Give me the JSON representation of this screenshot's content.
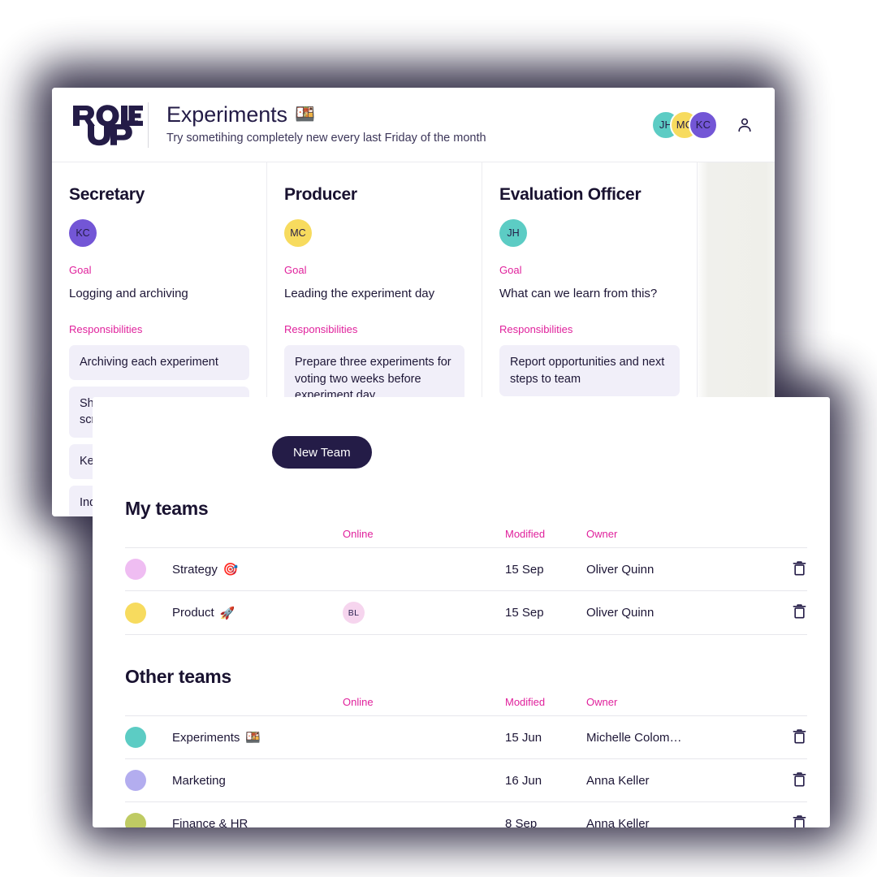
{
  "board": {
    "logo_text_top": "ROLE",
    "logo_text_bottom": "UP",
    "title": "Experiments",
    "title_emoji": "🍱",
    "subtitle": "Try sometihing completely new every last Friday of the month",
    "header_avatars": [
      {
        "initials": "JH",
        "color": "#5CCCC4"
      },
      {
        "initials": "MC",
        "color": "#F7DB5E"
      },
      {
        "initials": "KC",
        "color": "#7356D6"
      }
    ],
    "account_icon": "person-icon",
    "labels": {
      "goal": "Goal",
      "responsibilities": "Responsibilities"
    },
    "columns": [
      {
        "role": "Secretary",
        "avatar": {
          "initials": "KC",
          "color": "#7356D6"
        },
        "goal": "Logging and archiving",
        "responsibilities": [
          "Archiving each experiment",
          "Shooting photo's and creating scre… exp…",
          "Kee…",
          "Inqu… par…"
        ]
      },
      {
        "role": "Producer",
        "avatar": {
          "initials": "MC",
          "color": "#F7DB5E"
        },
        "goal": "Leading the experiment day",
        "responsibilities": [
          "Prepare three experiments for voting two weeks before experiment day",
          ""
        ]
      },
      {
        "role": "Evaluation Officer",
        "avatar": {
          "initials": "JH",
          "color": "#5CCCC4"
        },
        "goal": "What can we learn from this?",
        "responsibilities": [
          "Report opportunities and next steps to team",
          ""
        ]
      }
    ]
  },
  "teams_panel": {
    "new_team_label": "New Team",
    "columns": {
      "online": "Online",
      "modified": "Modified",
      "owner": "Owner"
    },
    "delete_icon": "trash-icon",
    "sections": [
      {
        "title": "My teams",
        "rows": [
          {
            "color": "#EFBDF2",
            "name": "Strategy",
            "emoji": "🎯",
            "online": [],
            "modified": "15 Sep",
            "owner": "Oliver Quinn"
          },
          {
            "color": "#F7DB5E",
            "name": "Product",
            "emoji": "🚀",
            "online": [
              {
                "initials": "BL",
                "color": "#F6D5EE"
              }
            ],
            "modified": "15 Sep",
            "owner": "Oliver Quinn"
          }
        ]
      },
      {
        "title": "Other teams",
        "rows": [
          {
            "color": "#5CCCC4",
            "name": "Experiments",
            "emoji": "🍱",
            "online": [],
            "modified": "15 Jun",
            "owner": "Michelle Colom…"
          },
          {
            "color": "#B3ADEF",
            "name": "Marketing",
            "emoji": "",
            "online": [],
            "modified": "16 Jun",
            "owner": "Anna Keller"
          },
          {
            "color": "#BFCB63",
            "name": "Finance & HR",
            "emoji": "",
            "online": [],
            "modified": "8 Sep",
            "owner": "Anna Keller"
          }
        ]
      }
    ]
  },
  "theme": {
    "accent_pink": "#e0219c",
    "ink": "#241c47",
    "card_bg": "#f1eff9",
    "shadow": "#1d1833"
  }
}
